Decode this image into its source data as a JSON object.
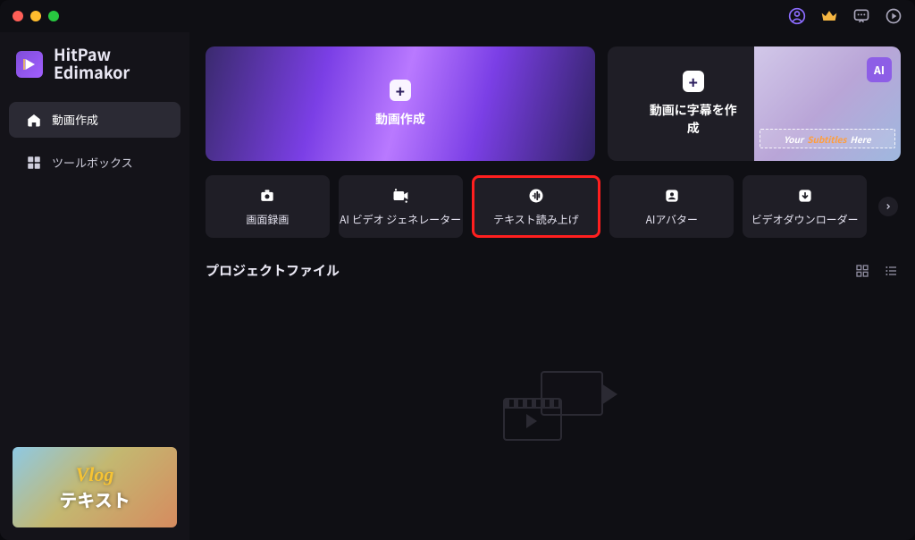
{
  "brand": {
    "line1": "HitPaw",
    "line2": "Edimakor"
  },
  "nav": {
    "video_create": "動画作成",
    "toolbox": "ツールボックス"
  },
  "vlog": {
    "title": "Vlog",
    "sub": "テキスト"
  },
  "hero": {
    "create_video": "動画作成",
    "create_subtitles": "動画に字幕を作\n成",
    "substrip_before": "Your",
    "substrip_accent": "Subtitles",
    "substrip_after": "Here",
    "ai_badge": "AI"
  },
  "tools": {
    "screen_record": "画面録画",
    "ai_video_gen": "AI ビデオ ジェネレーター",
    "tts": "テキスト読み上げ",
    "ai_avatar": "AIアバター",
    "video_downloader": "ビデオダウンローダー"
  },
  "projects": {
    "title": "プロジェクトファイル"
  }
}
